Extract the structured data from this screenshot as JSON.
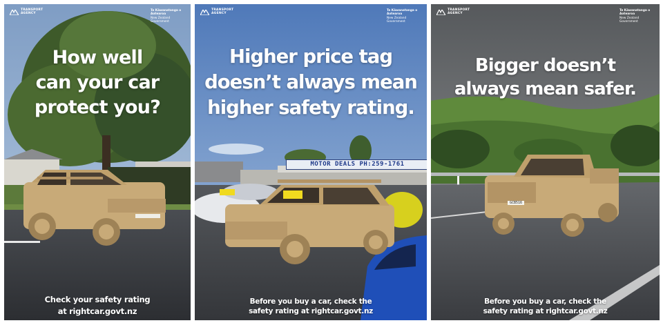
{
  "posters": [
    {
      "logo": {
        "line1": "TRANSPORT",
        "line2": "AGENCY"
      },
      "gov": {
        "line1": "Te Kāwanatanga o Aotearoa",
        "line2": "New Zealand Government"
      },
      "headline": [
        "How well",
        "can your car",
        "protect you?"
      ],
      "footer": [
        "Check your safety rating",
        "at rightcar.govt.nz"
      ]
    },
    {
      "logo": {
        "line1": "TRANSPORT",
        "line2": "AGENCY"
      },
      "gov": {
        "line1": "Te Kāwanatanga o Aotearoa",
        "line2": "New Zealand Government"
      },
      "headline": [
        "Higher price tag",
        "doesn’t always mean",
        "higher safety rating."
      ],
      "footer": [
        "Before you buy a car, check the",
        "safety rating at rightcar.govt.nz"
      ],
      "dealer_sign": "MOTOR DEALS PH:259-1761"
    },
    {
      "logo": {
        "line1": "TRANSPORT",
        "line2": "AGENCY"
      },
      "gov": {
        "line1": "Te Kāwanatanga o Aotearoa",
        "line2": "New Zealand Government"
      },
      "headline": [
        "Bigger doesn’t",
        "always mean safer."
      ],
      "footer": [
        "Before you buy a car, check the",
        "safety rating at rightcar.govt.nz"
      ],
      "plate": "GCB516"
    }
  ],
  "colors": {
    "cardboard": "#c8aa78",
    "cardboard_dark": "#9e8256",
    "text": "#ffffff"
  }
}
